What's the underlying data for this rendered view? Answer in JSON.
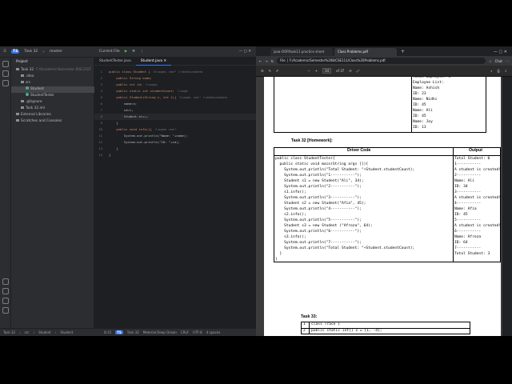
{
  "ide": {
    "window": {
      "project": "Task 32",
      "project_badge": "TS",
      "branch": "master",
      "run_config": "Current File"
    },
    "project_panel": {
      "title": "Project",
      "tree": [
        {
          "label": "Task 32",
          "detail": "F:\\Academic\\Semester 8\\SC2\\ST",
          "indent": 1,
          "kind": "folder"
        },
        {
          "label": ".idea",
          "indent": 2,
          "kind": "folder"
        },
        {
          "label": "src",
          "indent": 2,
          "kind": "folder"
        },
        {
          "label": "Student",
          "indent": 3,
          "kind": "class",
          "selected": true
        },
        {
          "label": "StudentTester",
          "indent": 3,
          "kind": "class"
        },
        {
          "label": ".gitignore",
          "indent": 2,
          "kind": "file"
        },
        {
          "label": "Task 32.iml",
          "indent": 2,
          "kind": "file"
        },
        {
          "label": "External Libraries",
          "indent": 1,
          "kind": "folder"
        },
        {
          "label": "Scratches and Consoles",
          "indent": 1,
          "kind": "folder"
        }
      ]
    },
    "tabs": [
      {
        "label": "StudentTester.java",
        "active": false
      },
      {
        "label": "Student.java",
        "active": true
      }
    ],
    "code": [
      {
        "n": "1",
        "text": "public class Student {",
        "hint": "19 usages   new *   2 related problems"
      },
      {
        "n": "2",
        "text": "    public String name;"
      },
      {
        "n": "3",
        "text": "    public int id;",
        "hint": "3 usages"
      },
      {
        "n": "4",
        "text": "    public static int studentCount;",
        "hint": "1 usage"
      },
      {
        "n": "5",
        "text": "    public Student(String n, int i){",
        "hint": "3 usages   new *   2 related problems"
      },
      {
        "n": "6",
        "text": "        name=n;"
      },
      {
        "n": "7",
        "text": "        id=i;"
      },
      {
        "n": "8",
        "text": "        Student.st++;",
        "current": true
      },
      {
        "n": "9",
        "text": "    }"
      },
      {
        "n": "10",
        "text": "    public void info(){",
        "hint": "3 usages   new *"
      },
      {
        "n": "11",
        "text": "        System.out.println(\"Name: \"+name);"
      },
      {
        "n": "12",
        "text": "        System.out.println(\"ID: \"+id);"
      },
      {
        "n": "13",
        "text": "    }"
      },
      {
        "n": "14",
        "text": "}"
      }
    ],
    "status": {
      "project": "Task 32",
      "crumb_src": "src",
      "crumb_class": "Student",
      "crumb_member": "Student",
      "position": "8:15",
      "badge": "TS",
      "task": "Task 32",
      "theme": "Material Deep Ocean",
      "line_sep": "CRLF",
      "encoding": "UTF-8",
      "indent": "4 spaces"
    }
  },
  "browser": {
    "tabs": [
      {
        "label": "java-OOP/task11 practice sheet",
        "active": false
      },
      {
        "label": "Class Problems.pdf",
        "active": true
      }
    ],
    "address_prefix": "File",
    "address": "F:/Academic/Semester%208/CSE111/Class%20Problems.pdf",
    "profile": "Chat",
    "page_current": "34",
    "page_total": "of 37",
    "zoom_minus": "−",
    "zoom_plus": "+"
  },
  "pdf": {
    "top_output": [
      "Total Employee: 4",
      "Employee List:",
      "Name: Ashish",
      "ID: 23",
      "Name: Nidhi",
      "ID: 45",
      "Name: Ali",
      "ID: 45",
      "Name: Joy",
      "ID: 13"
    ],
    "task32_title": "Task 32 [Homework]:",
    "col_driver": "Driver Code",
    "col_output": "Output",
    "driver_code": [
      "public class StudentTester{",
      "  public static void main(String args []){",
      "    System.out.println(\"Total Student: \"+Student.studentCount);",
      "    System.out.println(\"1-----------\");",
      "    Student s1 = new Student(\"Ali\", 34);",
      "    System.out.println(\"2-----------\");",
      "    s1.info();",
      "    System.out.println(\"3-----------\");",
      "    Student s2 = new Student(\"Afia\", 45);",
      "    System.out.println(\"4-----------\");",
      "    s2.info();",
      "    System.out.println(\"5-----------\");",
      "    Student s3 = new Student (\"Afroza\", 64);",
      "    System.out.println(\"6-----------\");",
      "    s3.info();",
      "    System.out.println(\"7-----------\");",
      "    System.out.println(\"Total Student: \"+Student.studentCount);",
      "  }",
      "}"
    ],
    "output": [
      "Total Student: 0",
      "1-----------",
      "A student is created!",
      "2-----------",
      "Name: Ali",
      "ID: 34",
      "3-----------",
      "A student is created!",
      "4-----------",
      "Name: Afia",
      "ID: 45",
      "5-----------",
      "A student is created!",
      "6-----------",
      "Name: Afroza",
      "ID: 64",
      "7-----------",
      "Total Student: 3"
    ],
    "task33_title": "Task 33:",
    "task33_rows": [
      {
        "n": "1",
        "code": "class Trace {"
      },
      {
        "n": "2",
        "code": "public static int[] x = {1, -4};"
      }
    ]
  }
}
